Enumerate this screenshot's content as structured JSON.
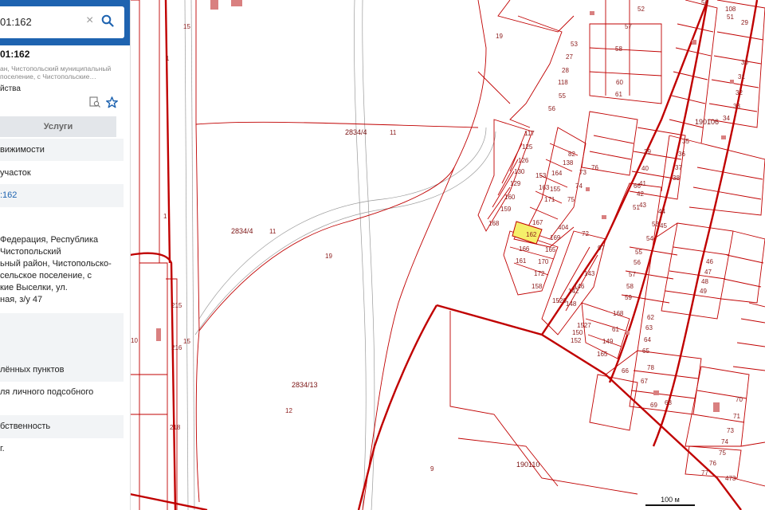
{
  "search": {
    "value": "01:162",
    "clear_icon": "×"
  },
  "object": {
    "title": "01:162",
    "address_lines": [
      "ан, Чистопольский муниципальный",
      "поселение, с Чистопольские…"
    ],
    "kind": "йства"
  },
  "tabs": {
    "services_label": "Услуги"
  },
  "rows": [
    {
      "text": "вижимости",
      "style": "alt"
    },
    {
      "text": "участок",
      "style": "plain"
    },
    {
      "text": ":162",
      "style": "link"
    },
    {
      "text": "",
      "style": "plain"
    },
    {
      "text": "Федерация, Республика\nЧистопольский\nьный район, Чистопольско-\nсельское поселение, с\nкие Выселки, ул.\nная, з/у 47",
      "style": "plain"
    },
    {
      "text": "",
      "style": "alt"
    },
    {
      "text": "лённых пунктов",
      "style": "alt"
    },
    {
      "text": "ля личного подсобного",
      "style": "plain"
    },
    {
      "text": "бственность",
      "style": "alt"
    },
    {
      "text": "г.",
      "style": "plain"
    }
  ],
  "map": {
    "parcel_color": "#c00000",
    "highlight_color": "#f5ef6a",
    "selected_parcel": "162",
    "labels": [
      "1",
      "1",
      "15",
      "15",
      "19",
      "19",
      "11",
      "11",
      "12",
      "9",
      "10",
      "2834/4",
      "2834/4",
      "2834/13",
      "190106",
      "190110",
      "215",
      "216",
      "218",
      "473",
      "117",
      "125",
      "126",
      "130",
      "129",
      "160",
      "159",
      "168",
      "167",
      "162",
      "169",
      "165",
      "170",
      "172",
      "166",
      "161",
      "158",
      "404",
      "171",
      "163",
      "153",
      "155",
      "164",
      "82",
      "138",
      "73",
      "74",
      "75",
      "76",
      "72",
      "97",
      "143",
      "142",
      "146",
      "148",
      "1520",
      "1527",
      "150",
      "152",
      "149",
      "165",
      "168",
      "61",
      "66",
      "51",
      "53",
      "54",
      "55",
      "56",
      "57",
      "58",
      "59",
      "60",
      "61",
      "62",
      "63",
      "64",
      "65",
      "66",
      "67",
      "68",
      "69",
      "70",
      "71",
      "73",
      "74",
      "75",
      "76",
      "77",
      "78",
      "108",
      "29",
      "30",
      "31",
      "32",
      "33",
      "34",
      "35",
      "36",
      "37",
      "38",
      "39",
      "40",
      "41",
      "42",
      "43",
      "44",
      "45",
      "46",
      "47",
      "48",
      "49",
      "50",
      "51",
      "52",
      "53",
      "27",
      "28",
      "118",
      "55",
      "56",
      "57",
      "58",
      "61",
      "62",
      "63",
      "64",
      "67",
      "68"
    ],
    "scale_label": "100 м"
  }
}
